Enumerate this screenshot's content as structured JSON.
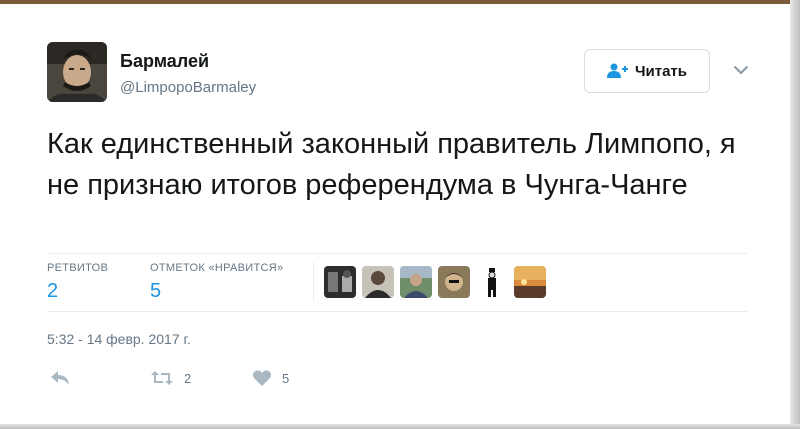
{
  "user": {
    "name": "Бармалей",
    "handle": "@LimpopoBarmaley"
  },
  "follow_button": {
    "label": "Читать"
  },
  "tweet": {
    "text": "Как единственный законный правитель Лимпопо, я не признаю итогов референдума в Чунга-Чанге",
    "timestamp": "5:32 - 14 февр. 2017 г."
  },
  "stats": {
    "retweets_label": "РЕТВИТОВ",
    "retweets_count": "2",
    "likes_label": "ОТМЕТОК «НРАВИТСЯ»",
    "likes_count": "5"
  },
  "actions": {
    "retweet_count": "2",
    "like_count": "5"
  },
  "colors": {
    "link_blue": "#1b95e0",
    "muted_gray": "#657786",
    "text": "#14171a"
  },
  "icons": [
    "follow-person-plus-icon",
    "chevron-down-icon",
    "reply-icon",
    "retweet-icon",
    "heart-icon"
  ]
}
